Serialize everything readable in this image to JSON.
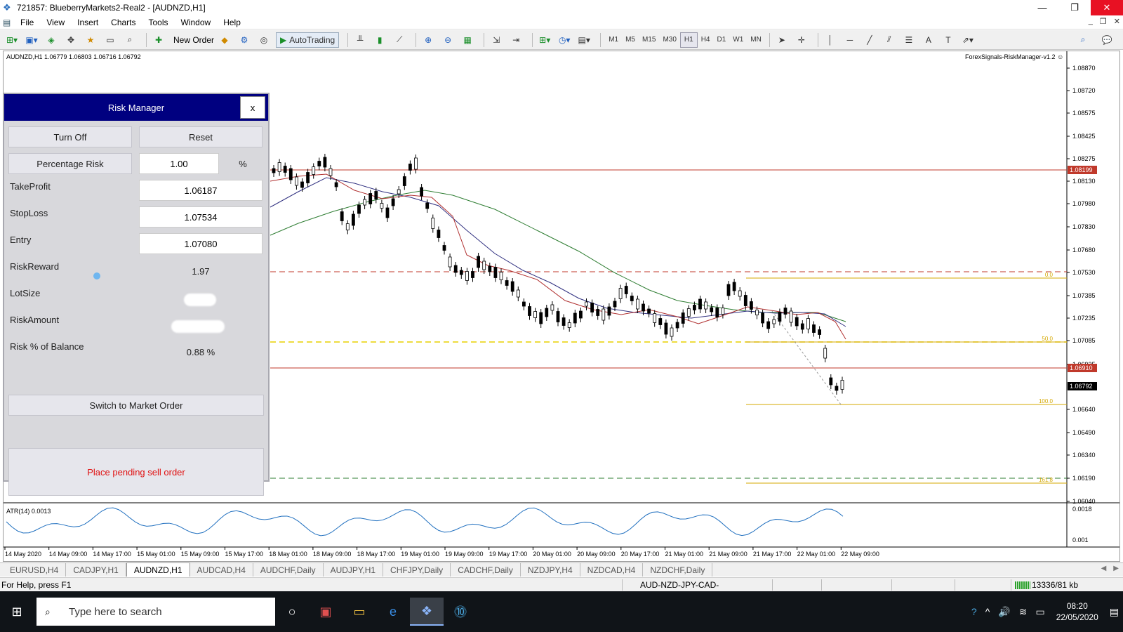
{
  "window": {
    "title": "721857: BlueberryMarkets2-Real2 - [AUDNZD,H1]",
    "app_icon": "mt4-icon"
  },
  "menu": {
    "items": [
      "File",
      "View",
      "Insert",
      "Charts",
      "Tools",
      "Window",
      "Help"
    ]
  },
  "toolbar": {
    "new_order_label": "New Order",
    "autotrading_label": "AutoTrading",
    "timeframes": [
      "M1",
      "M5",
      "M15",
      "M30",
      "H1",
      "H4",
      "D1",
      "W1",
      "MN"
    ],
    "active_timeframe": "H1"
  },
  "chart": {
    "header": "AUDNZD,H1  1.06779 1.06803 1.06716 1.06792",
    "ea_label": "ForexSignals-RiskManager-v1.2",
    "atr_label": "ATR(14) 0.0013",
    "atr_axis_labels": [
      "0.0018",
      "0.001"
    ],
    "price_axis_labels": [
      "1.08870",
      "1.08720",
      "1.08575",
      "1.08425",
      "1.08275",
      "1.08130",
      "1.07980",
      "1.07830",
      "1.07680",
      "1.07530",
      "1.07385",
      "1.07235",
      "1.07085",
      "1.06935",
      "1.06640",
      "1.06490",
      "1.06340",
      "1.06190",
      "1.06040"
    ],
    "price_tags": [
      {
        "value": "1.08199",
        "color": "#c0392b"
      },
      {
        "value": "1.06910",
        "color": "#c0392b"
      },
      {
        "value": "1.06792",
        "color": "#000000"
      }
    ],
    "fib_labels": [
      "0.0",
      "50.0",
      "100.0",
      "161.8"
    ],
    "time_labels": [
      "14 May 2020",
      "14 May 09:00",
      "14 May 17:00",
      "15 May 01:00",
      "15 May 09:00",
      "15 May 17:00",
      "18 May 01:00",
      "18 May 09:00",
      "18 May 17:00",
      "19 May 01:00",
      "19 May 09:00",
      "19 May 17:00",
      "20 May 01:00",
      "20 May 09:00",
      "20 May 17:00",
      "21 May 01:00",
      "21 May 09:00",
      "21 May 17:00",
      "22 May 01:00",
      "22 May 09:00"
    ]
  },
  "risk_manager": {
    "title": "Risk Manager",
    "close_label": "x",
    "turn_off_label": "Turn Off",
    "reset_label": "Reset",
    "percentage_risk_label": "Percentage Risk",
    "percentage_risk_value": "1.00",
    "percent_sign": "%",
    "take_profit_label": "TakeProfit",
    "take_profit_value": "1.06187",
    "stop_loss_label": "StopLoss",
    "stop_loss_value": "1.07534",
    "entry_label": "Entry",
    "entry_value": "1.07080",
    "risk_reward_label": "RiskReward",
    "risk_reward_value": "1.97",
    "lot_size_label": "LotSize",
    "risk_amount_label": "RiskAmount",
    "risk_balance_label": "Risk % of Balance",
    "risk_balance_value": "0.88 %",
    "switch_label": "Switch to Market Order",
    "status_text": "Place pending sell order"
  },
  "tabs": {
    "items": [
      "EURUSD,H4",
      "CADJPY,H1",
      "AUDNZD,H1",
      "AUDCAD,H4",
      "AUDCHF,Daily",
      "AUDJPY,H1",
      "CHFJPY,Daily",
      "CADCHF,Daily",
      "NZDJPY,H4",
      "NZDCAD,H4",
      "NZDCHF,Daily"
    ],
    "active": "AUDNZD,H1"
  },
  "status": {
    "help_text": "For Help, press F1",
    "profile": "AUD-NZD-JPY-CAD-",
    "connection": "13336/81 kb"
  },
  "taskbar": {
    "search_placeholder": "Type here to search",
    "time": "08:20",
    "date": "22/05/2020"
  },
  "colors": {
    "panel_header": "#000080",
    "status_text": "#e01010",
    "bull_candle": "#ffffff",
    "bear_candle": "#000000",
    "ma_fast": "#b03030",
    "ma_mid": "#303080",
    "ma_slow": "#2e7d32",
    "fib_line": "#d4a800",
    "stop_line": "#c0392b",
    "tp_line": "#2e7d32"
  }
}
